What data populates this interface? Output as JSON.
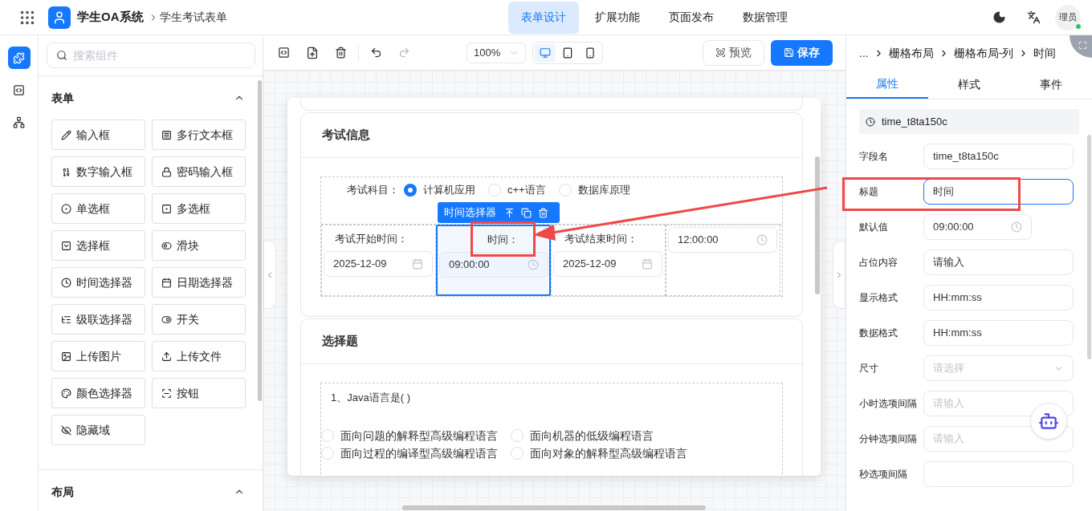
{
  "app": {
    "name": "学生OA系统",
    "breadcrumb": "学生考试表单"
  },
  "nav_tabs": [
    {
      "label": "表单设计",
      "selected": true
    },
    {
      "label": "扩展功能",
      "selected": false
    },
    {
      "label": "页面发布",
      "selected": false
    },
    {
      "label": "数据管理",
      "selected": false
    }
  ],
  "user": {
    "avatar_text": "理员",
    "online": true
  },
  "left_rail": [
    {
      "kind": "components",
      "selected": true
    },
    {
      "kind": "code",
      "selected": false
    },
    {
      "kind": "tree",
      "selected": false
    }
  ],
  "component_search": {
    "placeholder": "搜索组件"
  },
  "component_groups": [
    {
      "title": "表单",
      "expanded": true,
      "items": [
        {
          "label": "输入框"
        },
        {
          "label": "多行文本框"
        },
        {
          "label": "数字输入框"
        },
        {
          "label": "密码输入框"
        },
        {
          "label": "单选框"
        },
        {
          "label": "多选框"
        },
        {
          "label": "选择框"
        },
        {
          "label": "滑块"
        },
        {
          "label": "时间选择器"
        },
        {
          "label": "日期选择器"
        },
        {
          "label": "级联选择器"
        },
        {
          "label": "开关"
        },
        {
          "label": "上传图片"
        },
        {
          "label": "上传文件"
        },
        {
          "label": "颜色选择器"
        },
        {
          "label": "按钮"
        },
        {
          "label": "隐藏域"
        }
      ]
    },
    {
      "title": "布局",
      "expanded": true
    }
  ],
  "toolbar": {
    "zoom": "100%",
    "devices": [
      {
        "kind": "desktop",
        "selected": true
      },
      {
        "kind": "tablet",
        "selected": false
      },
      {
        "kind": "phone",
        "selected": false
      }
    ],
    "preview": "预览",
    "save": "保存"
  },
  "form": {
    "sections": [
      {
        "kind": "exam_info",
        "title": "考试信息",
        "radio_group": {
          "label": "考试科目：",
          "options": [
            {
              "label": "计算机应用",
              "selected": true
            },
            {
              "label": "c++语言",
              "selected": false
            },
            {
              "label": "数据库原理",
              "selected": false
            }
          ]
        },
        "selection_toolbar": {
          "label": "时间选择器"
        },
        "columns": [
          {
            "label": "考试开始时间：",
            "value": "2025-12-09",
            "kind": "date",
            "selected": false
          },
          {
            "label": "时间：",
            "value": "09:00:00",
            "kind": "time",
            "selected": true
          },
          {
            "label": "考试结束时间：",
            "value": "2025-12-09",
            "kind": "date",
            "selected": false
          },
          {
            "value": "12:00:00",
            "kind": "time",
            "selected": false
          }
        ]
      },
      {
        "kind": "question",
        "title": "选择题",
        "question": "1、Java语言是( )",
        "options": [
          {
            "label": "面向问题的解释型高级编程语言",
            "selected": false
          },
          {
            "label": "面向机器的低级编程语言",
            "selected": false
          },
          {
            "label": "面向过程的编译型高级编程语言",
            "selected": false
          },
          {
            "label": "面向对象的解释型高级编程语言",
            "selected": false
          }
        ]
      }
    ]
  },
  "properties": {
    "breadcrumb": [
      "...",
      "栅格布局",
      "栅格布局-列",
      "时间"
    ],
    "tabs": [
      {
        "label": "属性",
        "selected": true
      },
      {
        "label": "样式",
        "selected": false
      },
      {
        "label": "事件",
        "selected": false
      }
    ],
    "field_id": "time_t8ta150c",
    "rows": [
      {
        "label": "字段名",
        "kind": "input",
        "value": "time_t8ta150c",
        "focused": false
      },
      {
        "label": "标题",
        "kind": "input",
        "value": "时间",
        "focused": true
      },
      {
        "label": "默认值",
        "kind": "time",
        "value": "09:00:00",
        "focused": false
      },
      {
        "label": "占位内容",
        "kind": "input",
        "value": "请输入",
        "focused": false
      },
      {
        "label": "显示格式",
        "kind": "input",
        "value": "HH:mm:ss",
        "focused": false
      },
      {
        "label": "数据格式",
        "kind": "input",
        "value": "HH:mm:ss",
        "focused": false
      },
      {
        "label": "尺寸",
        "kind": "select",
        "placeholder": "请选择",
        "focused": false
      },
      {
        "label": "小时选项间隔",
        "kind": "input",
        "placeholder": "请输入",
        "focused": false
      },
      {
        "label": "分钟选项间隔",
        "kind": "input",
        "placeholder": "请输入",
        "focused": false
      },
      {
        "label": "秒选项间隔",
        "kind": "input",
        "focused": false
      }
    ]
  }
}
